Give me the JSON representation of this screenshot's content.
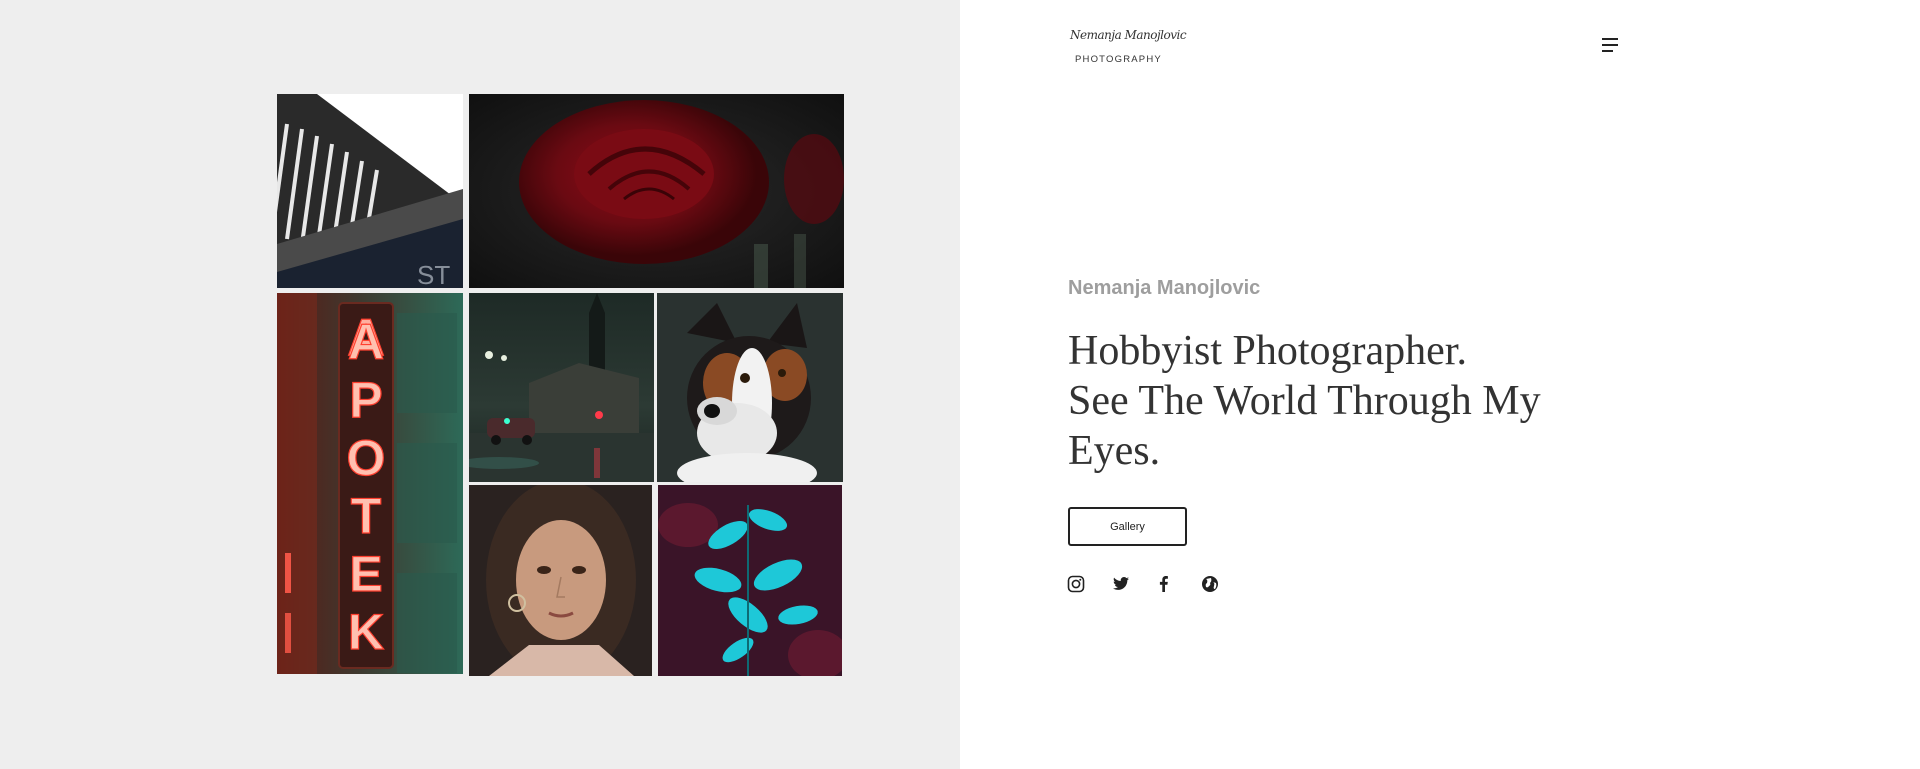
{
  "header": {
    "logo_signature": "Nemanja Manojlovic",
    "logo_subtitle": "PHOTOGRAPHY",
    "menu_icon": "hamburger-menu-icon"
  },
  "gallery_grid": {
    "photos": [
      {
        "subject": "building",
        "description": "architectural overhang photo"
      },
      {
        "subject": "rose",
        "description": "red rose photo"
      },
      {
        "subject": "apotek-sign",
        "description": "neon APOTEK sign photo"
      },
      {
        "subject": "night-street",
        "description": "night street with church photo"
      },
      {
        "subject": "dog",
        "description": "dog portrait photo"
      },
      {
        "subject": "portrait",
        "description": "woman portrait photo"
      },
      {
        "subject": "leaves",
        "description": "cyan leaves photo"
      }
    ],
    "sign_text": "APOTEK"
  },
  "hero": {
    "author": "Nemanja Manojlovic",
    "headline_lines": [
      "Hobbyist Photographer.",
      "See The World Through My",
      "Eyes."
    ],
    "gallery_button_label": "Gallery"
  },
  "social": [
    {
      "name": "instagram",
      "icon": "instagram-icon"
    },
    {
      "name": "twitter",
      "icon": "twitter-icon"
    },
    {
      "name": "facebook",
      "icon": "facebook-icon"
    },
    {
      "name": "website",
      "icon": "globe-icon"
    }
  ],
  "colors": {
    "left_background": "#eeeeee",
    "right_background": "#ffffff",
    "author_gray": "#9e9e9e",
    "headline_dark": "#333333"
  }
}
